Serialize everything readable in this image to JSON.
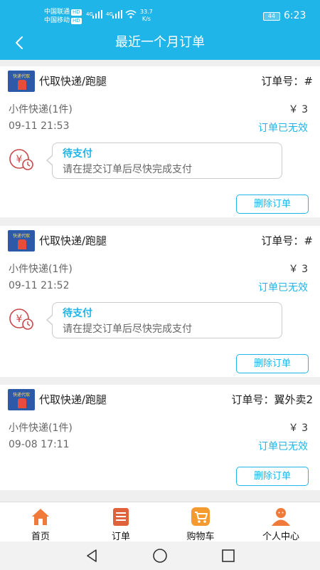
{
  "status_bar": {
    "carrier1": "中国联通",
    "carrier2": "中国移动",
    "hd": "HD",
    "net1": "4G",
    "net2": "4G",
    "speed_value": "33.7",
    "speed_unit": "K/s",
    "battery": "44",
    "time": "6:23"
  },
  "header": {
    "title": "最近一个月订单"
  },
  "orders": [
    {
      "shop_name": "代取快递/跑腿",
      "logo_text": "快递代取",
      "order_no": "订单号：#",
      "item": "小件快递(1件)",
      "price": "￥ 3",
      "time": "09-11 21:53",
      "status": "订单已无效",
      "payment": {
        "title": "待支付",
        "message": "请在提交订单后尽快完成支付"
      },
      "delete_label": "删除订单"
    },
    {
      "shop_name": "代取快递/跑腿",
      "logo_text": "快递代取",
      "order_no": "订单号：#",
      "item": "小件快递(1件)",
      "price": "￥ 3",
      "time": "09-11 21:52",
      "status": "订单已无效",
      "payment": {
        "title": "待支付",
        "message": "请在提交订单后尽快完成支付"
      },
      "delete_label": "删除订单"
    },
    {
      "shop_name": "代取快递/跑腿",
      "logo_text": "快递代取",
      "order_no": "订单号：翼外卖2",
      "item": "小件快递(1件)",
      "price": "￥ 3",
      "time": "09-08 17:11",
      "status": "订单已无效",
      "delete_label": "删除订单"
    }
  ],
  "tabs": [
    {
      "label": "首页",
      "icon": "home-icon",
      "color": "#f07a3a"
    },
    {
      "label": "订单",
      "icon": "orders-icon",
      "color": "#e0623a"
    },
    {
      "label": "购物车",
      "icon": "cart-icon",
      "color": "#f59a2e"
    },
    {
      "label": "个人中心",
      "icon": "profile-icon",
      "color": "#ef7a3a"
    }
  ],
  "colors": {
    "accent": "#20b5e8",
    "background": "#efefef",
    "pay_icon": "#c9474a"
  }
}
